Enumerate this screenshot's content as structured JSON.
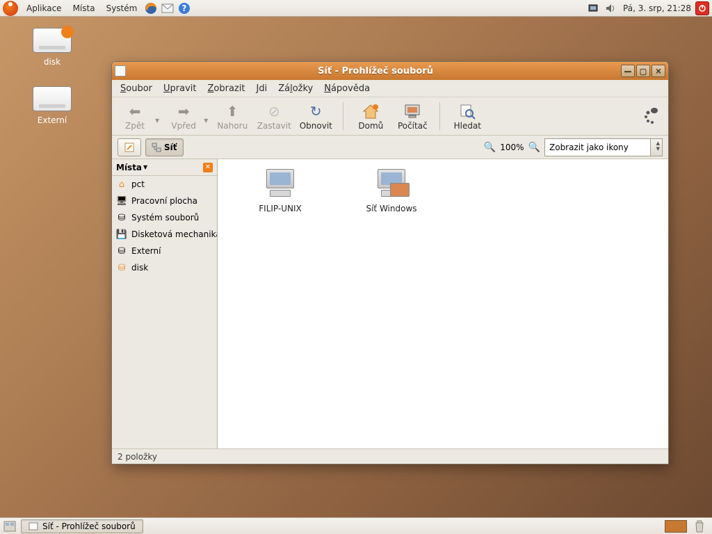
{
  "top_panel": {
    "menus": {
      "apps": "Aplikace",
      "places": "Místa",
      "system": "Systém"
    },
    "clock": "Pá,  3. srp, 21:28"
  },
  "desktop": {
    "icons": [
      {
        "label": "disk"
      },
      {
        "label": "Externí"
      }
    ]
  },
  "window": {
    "title": "Síť - Prohlížeč souborů",
    "menu": {
      "file": "Soubor",
      "edit": "Upravit",
      "view": "Zobrazit",
      "go": "Jdi",
      "bookmarks": "Záložky",
      "help": "Nápověda"
    },
    "toolbar": {
      "back": "Zpět",
      "forward": "Vpřed",
      "up": "Nahoru",
      "stop": "Zastavit",
      "reload": "Obnovit",
      "home": "Domů",
      "computer": "Počítač",
      "search": "Hledat"
    },
    "location": {
      "path_button": "Síť",
      "zoom": "100%",
      "view_mode": "Zobrazit jako ikony"
    },
    "sidebar": {
      "header": "Místa",
      "items": [
        {
          "label": "pct"
        },
        {
          "label": "Pracovní plocha"
        },
        {
          "label": "Systém souborů"
        },
        {
          "label": "Disketová mechanika"
        },
        {
          "label": "Externí"
        },
        {
          "label": "disk"
        }
      ]
    },
    "content": {
      "items": [
        {
          "label": "FILIP-UNIX"
        },
        {
          "label": "Síť Windows"
        }
      ]
    },
    "status": "2 položky"
  },
  "bottom_panel": {
    "task": "Síť - Prohlížeč souborů"
  }
}
